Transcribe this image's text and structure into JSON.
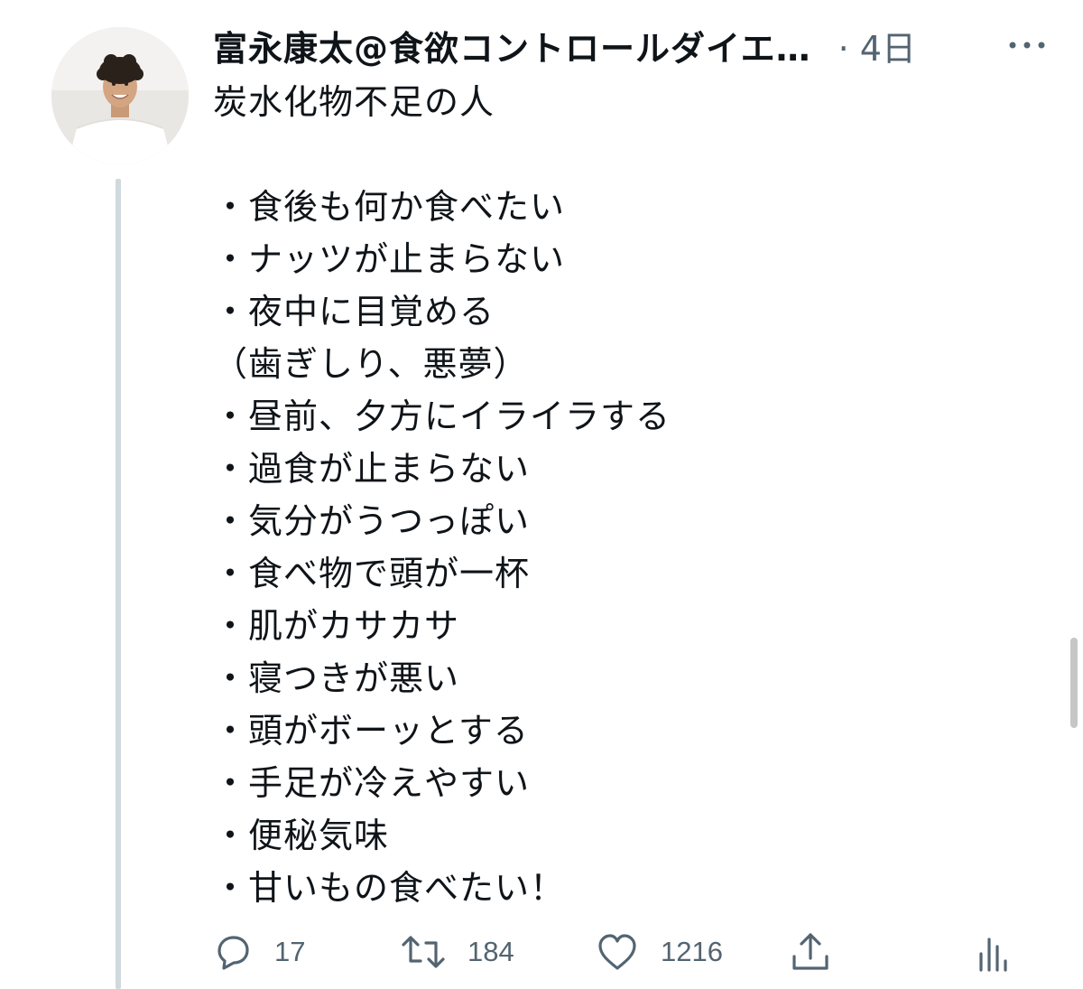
{
  "tweet": {
    "author": {
      "display_name": "富永康太@食欲コントロールダイエ…"
    },
    "timestamp": "· 4日",
    "heading": "炭水化物不足の人",
    "items": [
      "・食後も何か食べたい",
      "・ナッツが止まらない",
      "・夜中に目覚める",
      "（歯ぎしり、悪夢）",
      "・昼前、夕方にイライラする",
      "・過食が止まらない",
      "・気分がうつっぽい",
      "・食べ物で頭が一杯",
      "・肌がカサカサ",
      "・寝つきが悪い",
      "・頭がボーッとする",
      "・手足が冷えやすい",
      "・便秘気味",
      "・甘いもの食べたい！"
    ]
  },
  "actions": {
    "reply_count": "17",
    "retweet_count": "184",
    "like_count": "1216"
  },
  "icons": {
    "more": "more-horizontal-icon",
    "reply": "reply-bubble-icon",
    "retweet": "retweet-icon",
    "like": "heart-icon",
    "share": "share-icon",
    "analytics": "analytics-icon"
  },
  "colors": {
    "text": "#0f1419",
    "secondary": "#536471",
    "thread_line": "#cfd9de"
  }
}
